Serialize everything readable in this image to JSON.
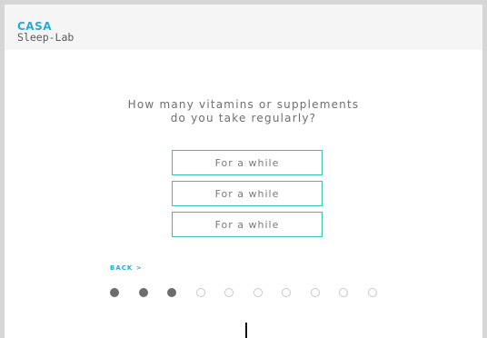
{
  "brand": {
    "line1": "CASA",
    "line2": "Sleep-Lab"
  },
  "question": {
    "line1": "How many vitamins or supplements",
    "line2": "do you take regularly?"
  },
  "options": [
    "For a while",
    "For a while",
    "For a while"
  ],
  "back_label": "BACK >",
  "progress": {
    "total": 10,
    "completed": 3
  },
  "colors": {
    "brand_blue": "#2aa8d8",
    "option_border": "#3bbfb4",
    "dot_filled": "#6c6c6c",
    "dot_empty": "#c8c8c8"
  }
}
